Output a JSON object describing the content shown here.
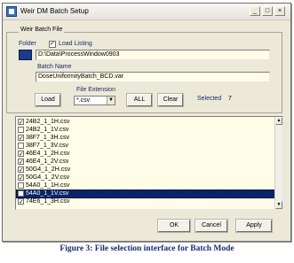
{
  "window": {
    "title": "Weir DM Batch Setup",
    "controls": {
      "minimize": "_",
      "maximize": "□",
      "close": "×"
    }
  },
  "group": {
    "legend": "Weir Batch File"
  },
  "folder": {
    "label": "Folder",
    "load_listing_label": "Load Listing",
    "load_listing_checked": true,
    "path": "D:\\Data\\ProcessWindow0903"
  },
  "batch": {
    "name_label": "Batch Name",
    "name_value": "DoseUniformityBatch_BCD.var"
  },
  "buttons": {
    "load": "Load",
    "all": "ALL",
    "clear": "Clear",
    "ok": "OK",
    "cancel": "Cancel",
    "apply": "Apply"
  },
  "extension": {
    "label": "File Extension",
    "value": "*.csv"
  },
  "selected": {
    "label": "Selected",
    "count": "7"
  },
  "files": [
    {
      "name": "24B2_1_1H.csv",
      "checked": true
    },
    {
      "name": "24B2_1_1V.csv",
      "checked": false
    },
    {
      "name": "38F7_1_3H.csv",
      "checked": true
    },
    {
      "name": "38F7_1_3V.csv",
      "checked": false
    },
    {
      "name": "46E4_1_2H.csv",
      "checked": true
    },
    {
      "name": "46E4_1_2V.csv",
      "checked": true
    },
    {
      "name": "50G4_1_2H.csv",
      "checked": true
    },
    {
      "name": "50G4_1_2V.csv",
      "checked": true
    },
    {
      "name": "54A0_1_1H.csv",
      "checked": false
    },
    {
      "name": "54A0_1_1V.csv",
      "checked": false,
      "selected": true
    },
    {
      "name": "74E6_1_3H.csv",
      "checked": true
    }
  ],
  "caption": "Figure 3: File selection interface for Batch Mode",
  "icons": {
    "title": "app-icon",
    "scroll_up": "▲",
    "scroll_down": "▼",
    "combo": "▼"
  },
  "colors": {
    "selection": "#0a246a",
    "field_bg": "#fffde8",
    "caption": "#1a2b6e"
  }
}
